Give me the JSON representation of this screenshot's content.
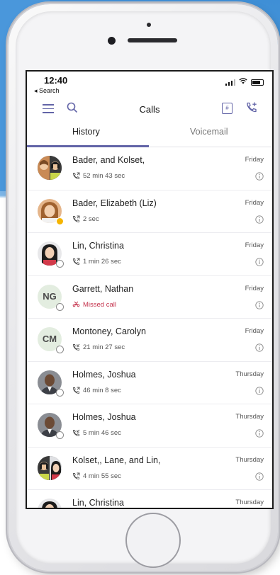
{
  "status_bar": {
    "time": "12:40",
    "back_label": "◂ Search"
  },
  "header": {
    "title": "Calls"
  },
  "tabs": [
    {
      "label": "History"
    },
    {
      "label": "Voicemail"
    }
  ],
  "calls": [
    {
      "name": "Bader, and Kolset,",
      "detail": "52 min 43 sec",
      "day": "Friday",
      "avatar_type": "group"
    },
    {
      "name": "Bader, Elizabeth (Liz)",
      "detail": "2 sec",
      "day": "Friday",
      "avatar_type": "photo",
      "presence": "away"
    },
    {
      "name": "Lin, Christina",
      "detail": "1 min 26 sec",
      "day": "Friday",
      "avatar_type": "photo",
      "presence": "offline"
    },
    {
      "name": "Garrett, Nathan",
      "detail": "Missed call",
      "day": "Friday",
      "avatar_type": "initials",
      "initials": "NG",
      "missed": true,
      "presence": "offline"
    },
    {
      "name": "Montoney, Carolyn",
      "detail": "21 min 27 sec",
      "day": "Friday",
      "avatar_type": "initials",
      "initials": "CM",
      "presence": "offline"
    },
    {
      "name": "Holmes, Joshua",
      "detail": "46 min 8 sec",
      "day": "Thursday",
      "avatar_type": "photo",
      "presence": "offline"
    },
    {
      "name": "Holmes, Joshua",
      "detail": "5 min 46 sec",
      "day": "Thursday",
      "avatar_type": "photo",
      "presence": "offline"
    },
    {
      "name": "Kolset,, Lane, and Lin,",
      "detail": "4 min 55 sec",
      "day": "Thursday",
      "avatar_type": "group"
    },
    {
      "name": "Lin, Christina",
      "detail": "",
      "day": "Thursday",
      "avatar_type": "photo"
    }
  ],
  "colors": {
    "accent": "#6264a7",
    "missed": "#c4314b"
  },
  "icons": [
    "hamburger-menu-icon",
    "search-icon",
    "dialpad-icon",
    "add-call-icon",
    "info-icon",
    "outgoing-call-icon",
    "missed-call-icon"
  ]
}
